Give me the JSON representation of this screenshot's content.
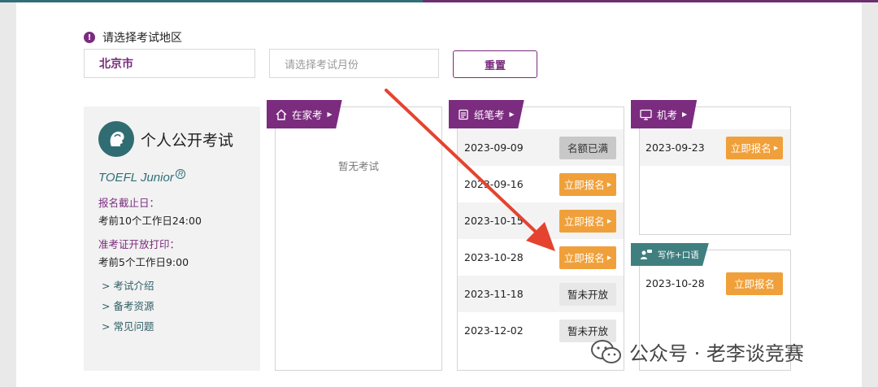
{
  "header": {
    "region_prompt": "请选择考试地区"
  },
  "filters": {
    "city_value": "北京市",
    "month_placeholder": "请选择考试月份",
    "reset_label": "重置"
  },
  "info": {
    "title": "个人公开考试",
    "brand": "TOEFL Junior",
    "brand_mark": "R",
    "deadline_label": "报名截止日：",
    "deadline_value": "考前10个工作日24:00",
    "admit_label": "准考证开放打印：",
    "admit_value": "考前5个工作日9:00",
    "links": [
      "考试介绍",
      "备考资源",
      "常见问题"
    ]
  },
  "columns": {
    "home": {
      "tag": "在家考",
      "empty_text": "暂无考试"
    },
    "paper": {
      "tag": "纸笔考",
      "rows": [
        {
          "date": "2023-09-09",
          "status": "名额已满"
        },
        {
          "date": "2023-09-16",
          "status": "立即报名"
        },
        {
          "date": "2023-10-15",
          "status": "立即报名"
        },
        {
          "date": "2023-10-28",
          "status": "立即报名"
        },
        {
          "date": "2023-11-18",
          "status": "暂未开放"
        },
        {
          "date": "2023-12-02",
          "status": "暂未开放"
        }
      ]
    },
    "computer": {
      "tag": "机考",
      "rows": [
        {
          "date": "2023-09-23",
          "status": "立即报名"
        }
      ]
    },
    "writing": {
      "tag": "写作+口语",
      "rows": [
        {
          "date": "2023-10-28",
          "status": "立即报名"
        }
      ]
    }
  },
  "watermark": {
    "text": "公众号 · 老李谈竞赛"
  },
  "colors": {
    "purple": "#7b2c7f",
    "teal": "#2f6f78",
    "orange": "#f0a03a",
    "arrow": "#e5432f"
  }
}
